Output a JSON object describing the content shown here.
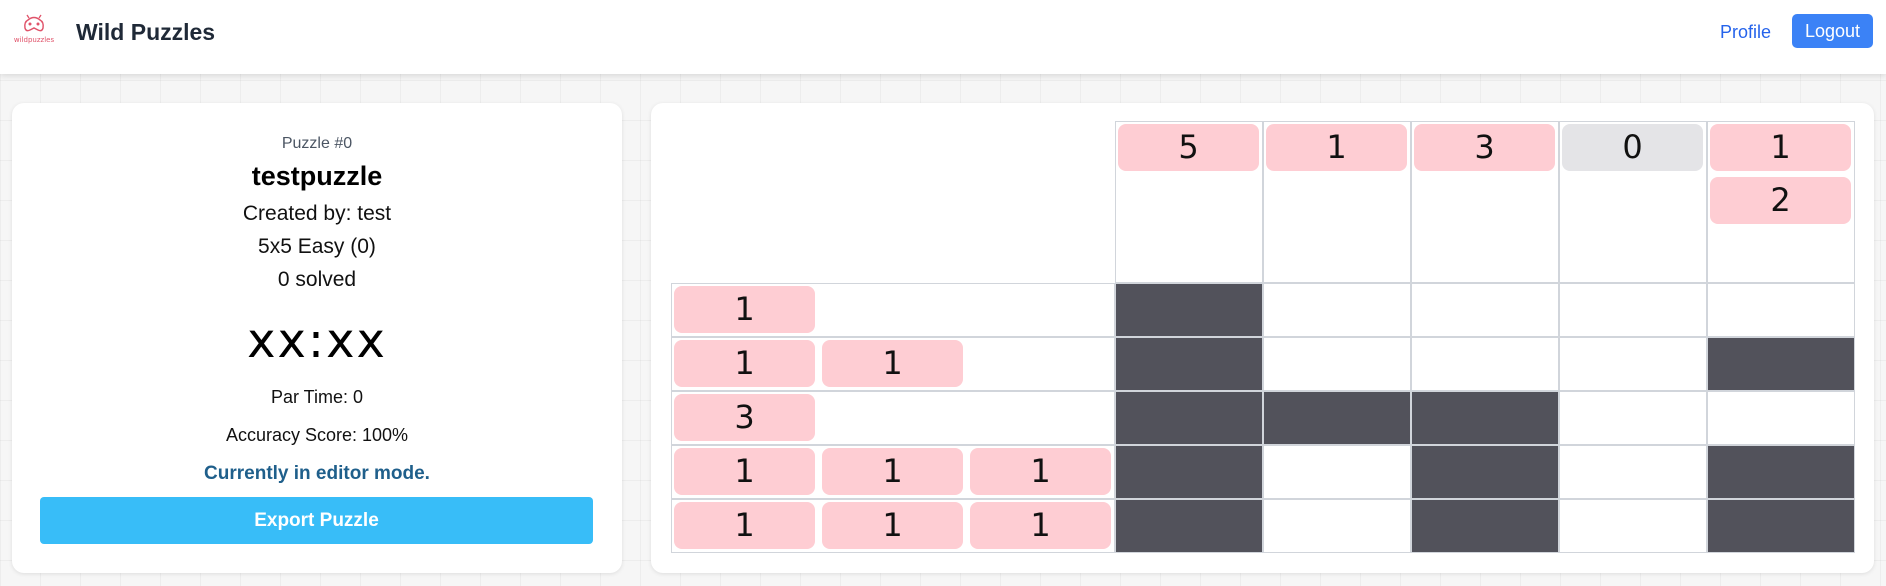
{
  "nav": {
    "logo_text": "wildpuzzles",
    "brand": "Wild Puzzles",
    "profile_label": "Profile",
    "logout_label": "Logout"
  },
  "info": {
    "puzzle_number": "Puzzle #0",
    "title": "testpuzzle",
    "created_by": "Created by: test",
    "size_difficulty": "5x5 Easy (0)",
    "solved": "0 solved",
    "timer": "xx:xx",
    "par_time": "Par Time: 0",
    "accuracy": "Accuracy Score: 100%",
    "mode_message": "Currently in editor mode.",
    "export_label": "Export Puzzle"
  },
  "puzzle": {
    "column_clues": [
      [
        "5"
      ],
      [
        "1"
      ],
      [
        "3"
      ],
      [
        "0"
      ],
      [
        "1",
        "2"
      ]
    ],
    "row_clues": [
      [
        "1"
      ],
      [
        "1",
        "1"
      ],
      [
        "3"
      ],
      [
        "1",
        "1",
        "1"
      ],
      [
        "1",
        "1",
        "1"
      ]
    ],
    "cells": [
      [
        1,
        0,
        0,
        0,
        0
      ],
      [
        1,
        0,
        0,
        0,
        1
      ],
      [
        1,
        1,
        1,
        0,
        0
      ],
      [
        1,
        0,
        1,
        0,
        1
      ],
      [
        1,
        0,
        1,
        0,
        1
      ]
    ]
  },
  "colors": {
    "clue_chip": "#fecdd3",
    "zero_clue_chip": "#e4e4e7",
    "filled_cell": "#52525b",
    "accent_blue": "#3b82f6",
    "export_button": "#38bdf8"
  }
}
